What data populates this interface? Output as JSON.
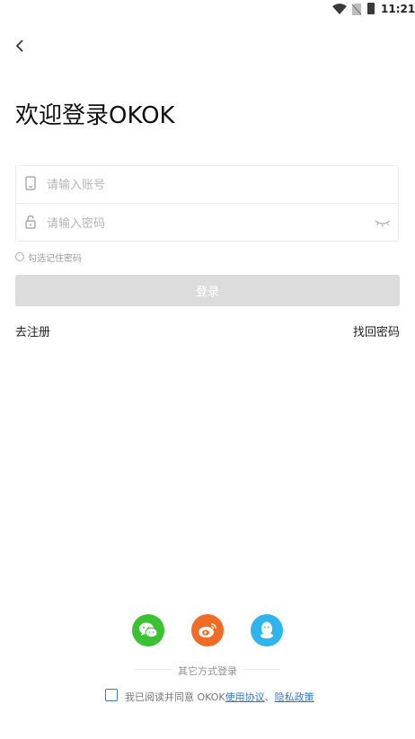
{
  "status_bar": {
    "time": "11:21"
  },
  "header": {
    "back_icon": "chevron-left-icon",
    "title": "欢迎登录OKOK"
  },
  "form": {
    "account_placeholder": "请输入账号",
    "password_placeholder": "请输入密码",
    "account_icon": "phone-icon",
    "password_icon": "lock-icon",
    "toggle_icon": "eye-closed-icon",
    "remember_label": "勾选记住密码",
    "remember_checked": false
  },
  "login_button": {
    "label": "登录",
    "color": "#dcdcdc"
  },
  "links": {
    "register": "去注册",
    "forgot": "找回密码"
  },
  "social": {
    "label": "其它方式登录",
    "buttons": [
      {
        "name": "wechat-icon",
        "color": "#3ac233"
      },
      {
        "name": "weibo-icon",
        "color": "#f06b24"
      },
      {
        "name": "qq-icon",
        "color": "#2eb5ee"
      }
    ]
  },
  "agreement": {
    "prefix": "我已阅读并同意 OKOK",
    "terms": "使用协议",
    "separator": "、",
    "privacy": "隐私政策",
    "checked": false,
    "link_color": "#2f78cc"
  }
}
